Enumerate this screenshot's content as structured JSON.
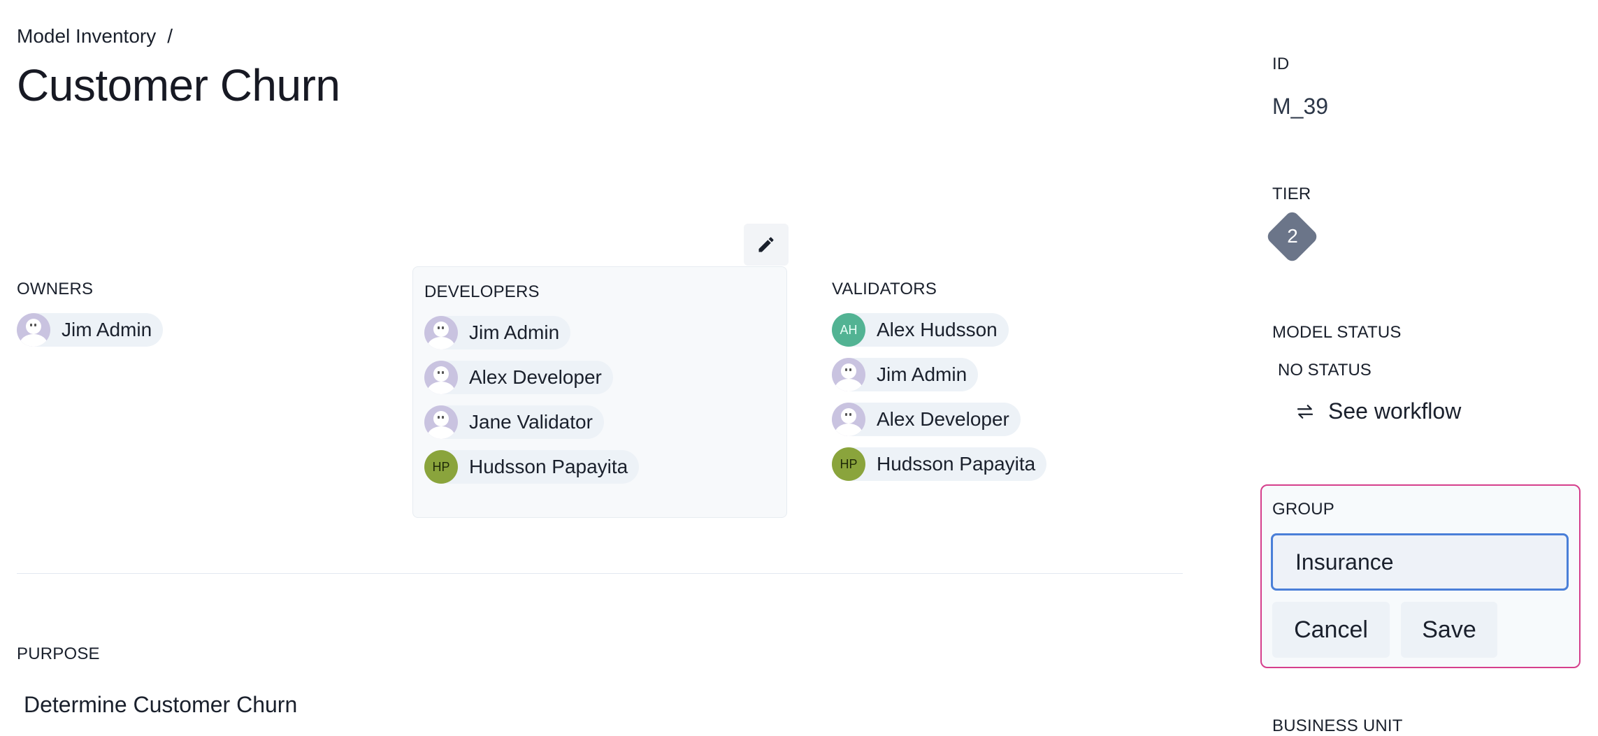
{
  "breadcrumb": {
    "parent": "Model Inventory",
    "separator": "/"
  },
  "title": "Customer Churn",
  "owners": {
    "label": "OWNERS",
    "people": [
      {
        "name": "Jim Admin",
        "avatar": "default"
      }
    ]
  },
  "developers": {
    "label": "DEVELOPERS",
    "people": [
      {
        "name": "Jim Admin",
        "avatar": "default"
      },
      {
        "name": "Alex Developer",
        "avatar": "default"
      },
      {
        "name": "Jane Validator",
        "avatar": "default"
      },
      {
        "name": "Hudsson Papayita",
        "avatar": "HP"
      }
    ]
  },
  "validators": {
    "label": "VALIDATORS",
    "people": [
      {
        "name": "Alex Hudsson",
        "avatar": "AH"
      },
      {
        "name": "Jim Admin",
        "avatar": "default"
      },
      {
        "name": "Alex Developer",
        "avatar": "default"
      },
      {
        "name": "Hudsson Papayita",
        "avatar": "HP"
      }
    ]
  },
  "purpose": {
    "label": "PURPOSE",
    "text": "Determine Customer Churn"
  },
  "sidebar": {
    "id_label": "ID",
    "id_value": "M_39",
    "tier_label": "TIER",
    "tier_value": "2",
    "status_label": "MODEL STATUS",
    "status_value": "NO STATUS",
    "workflow_link": "See workflow",
    "group_label": "GROUP",
    "group_value": "Insurance",
    "cancel_label": "Cancel",
    "save_label": "Save",
    "business_unit_label": "BUSINESS UNIT"
  },
  "icons": {
    "edit": "pencil-icon",
    "workflow": "arrows-swap-icon"
  },
  "colors": {
    "tier_badge": "#6b7589",
    "group_card_border": "#d53f8c",
    "input_focus": "#4a7fd8",
    "ah_avatar": "#52b393",
    "hp_avatar": "#8aa43c"
  }
}
